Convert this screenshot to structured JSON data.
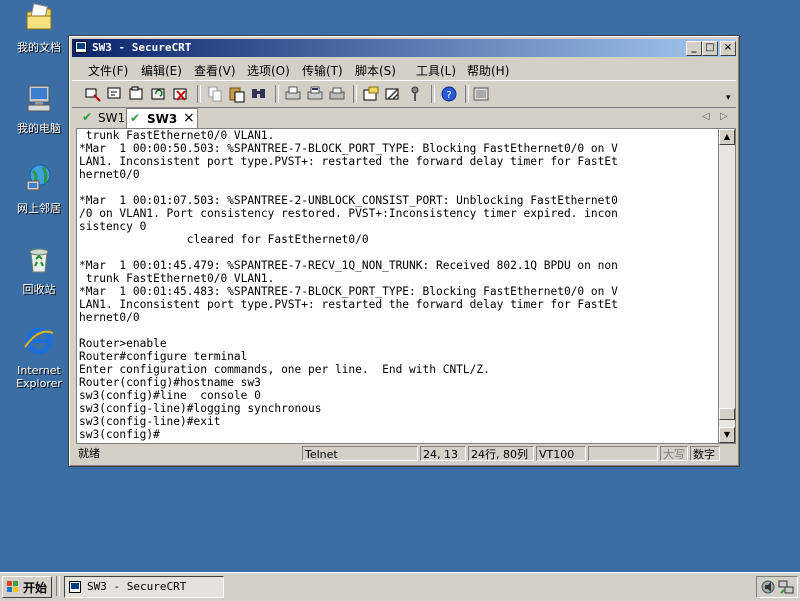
{
  "desktop": {
    "icons": [
      {
        "label": "我的文档",
        "icon": "my-documents-icon"
      },
      {
        "label": "我的电脑",
        "icon": "my-computer-icon"
      },
      {
        "label": "网上邻居",
        "icon": "network-places-icon"
      },
      {
        "label": "回收站",
        "icon": "recycle-bin-icon"
      },
      {
        "label_line1": "Internet",
        "label_line2": "Explorer",
        "icon": "internet-explorer-icon"
      }
    ],
    "background_color": "#3a6ea5"
  },
  "window": {
    "title": "SW3 - SecureCRT",
    "controls": {
      "minimize": "_",
      "maximize": "□",
      "close": "×"
    }
  },
  "menubar": {
    "items": [
      "文件(F)",
      "编辑(E)",
      "查看(V)",
      "选项(O)",
      "传输(T)",
      "脚本(S)",
      "工具(L)",
      "帮助(H)"
    ]
  },
  "toolbar": {
    "icons": [
      "connect-icon",
      "quick-connect-icon",
      "connect-tab-icon",
      "reconnect-icon",
      "disconnect-icon",
      "copy-icon",
      "paste-icon",
      "find-icon",
      "print-icon",
      "print-selection-icon",
      "print-setup-icon",
      "session-options-icon",
      "global-options-icon",
      "keymap-icon",
      "help-icon",
      "screenshot-icon"
    ]
  },
  "tabs": [
    {
      "label": "SW1",
      "active": false
    },
    {
      "label": "SW3",
      "active": true,
      "close": "×"
    }
  ],
  "tab_nav": {
    "prev": "◁",
    "next": "▷"
  },
  "terminal": {
    "lines": [
      " trunk FastEthernet0/0 VLAN1.",
      "*Mar  1 00:00:50.503: %SPANTREE-7-BLOCK_PORT_TYPE: Blocking FastEthernet0/0 on V",
      "LAN1. Inconsistent port type.PVST+: restarted the forward delay timer for FastEt",
      "hernet0/0",
      "",
      "*Mar  1 00:01:07.503: %SPANTREE-2-UNBLOCK_CONSIST_PORT: Unblocking FastEthernet0",
      "/0 on VLAN1. Port consistency restored. PVST+:Inconsistency timer expired. incon",
      "sistency 0",
      "                cleared for FastEthernet0/0",
      "",
      "*Mar  1 00:01:45.479: %SPANTREE-7-RECV_1Q_NON_TRUNK: Received 802.1Q BPDU on non",
      " trunk FastEthernet0/0 VLAN1.",
      "*Mar  1 00:01:45.483: %SPANTREE-7-BLOCK_PORT_TYPE: Blocking FastEthernet0/0 on V",
      "LAN1. Inconsistent port type.PVST+: restarted the forward delay timer for FastEt",
      "hernet0/0",
      "",
      "Router>enable",
      "Router#configure terminal",
      "Enter configuration commands, one per line.  End with CNTL/Z.",
      "Router(config)#hostname sw3",
      "sw3(config)#line  console 0",
      "sw3(config-line)#logging synchronous",
      "sw3(config-line)#exit",
      "sw3(config)#"
    ],
    "scroll_position": 0.97
  },
  "statusbar": {
    "ready": "就绪",
    "protocol": "Telnet",
    "cursor": "24, 13",
    "size": "24行, 80列",
    "emulation": "VT100",
    "caps": "大写",
    "num": "数字"
  },
  "taskbar": {
    "start_label": "开始",
    "task_label": "SW3 - SecureCRT",
    "tray_icons": [
      "volume-icon",
      "network-status-icon"
    ]
  }
}
